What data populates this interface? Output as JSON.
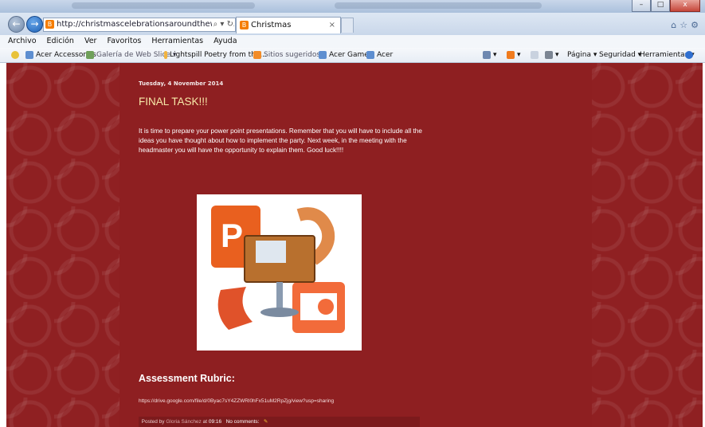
{
  "browser": {
    "address_url": "http://christmascelebrationsaroundtheworld.blogsp...",
    "address_controls": "⌕ ▾ ↻",
    "tab_title": "Christmas",
    "tab_close": "×",
    "right_icons": "⌂☆⚙",
    "window_buttons": [
      "–",
      "□",
      "x"
    ]
  },
  "menu": [
    "Archivo",
    "Edición",
    "Ver",
    "Favoritos",
    "Herramientas",
    "Ayuda"
  ],
  "favorites": {
    "items": [
      "Acer Accessorios",
      "Galería de Web Slice ▾",
      "Lightspill Poetry  from the...",
      "Sitios sugeridos ▾",
      "Acer Games",
      "Acer"
    ],
    "commands": [
      "Página ▾",
      "Seguridad ▾",
      "Herramientas ▾"
    ]
  },
  "post": {
    "date": "Tuesday, 4 November 2014",
    "title": "FINAL TASK!!!",
    "body": "It is time to prepare your power point presentations. Remember that you will have to include all the ideas you have thought about how to implement the party. Next week, in the meeting with the headmaster you will have the opportunity to explain them. Good luck!!!!",
    "subheading": "Assessment Rubric:",
    "link": "https://drive.google.com/file/d/0Byac7sY4ZZWRl0hFx51uM2RpZjg/view?usp=sharing",
    "footer": {
      "posted_by": "Posted by",
      "author": "Gloria Sánchez",
      "at": "at",
      "time": "09:16",
      "comments": "No comments:"
    }
  },
  "colors": {
    "page_bg": "#8f2022",
    "title": "#f7e9a8"
  }
}
